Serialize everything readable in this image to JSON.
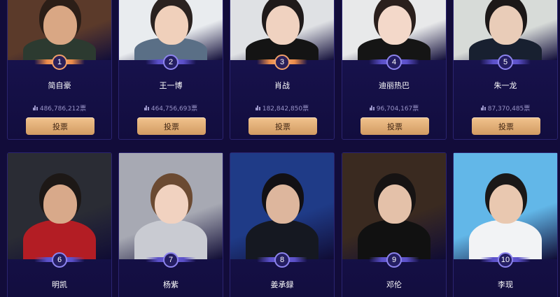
{
  "vote_label": "投票",
  "row1": [
    {
      "rank": "1",
      "name": "简自豪",
      "votes": "486,786,212票",
      "top": true,
      "colors": {
        "bg": "#5b3a2a",
        "skin": "#d9a784",
        "hair": "#2b1e17",
        "shirt": "#2c3a30"
      }
    },
    {
      "rank": "2",
      "name": "王一博",
      "votes": "464,756,693票",
      "top": false,
      "colors": {
        "bg": "#e9ecef",
        "skin": "#f0d0bb",
        "hair": "#2a2220",
        "shirt": "#5a6f86"
      }
    },
    {
      "rank": "3",
      "name": "肖战",
      "votes": "182,842,850票",
      "top": true,
      "colors": {
        "bg": "#dfe1e4",
        "skin": "#f0d2c0",
        "hair": "#1f1a1a",
        "shirt": "#141414"
      }
    },
    {
      "rank": "4",
      "name": "迪丽热巴",
      "votes": "96,704,167票",
      "top": false,
      "colors": {
        "bg": "#e8e9ea",
        "skin": "#f3d8c9",
        "hair": "#2a1f1c",
        "shirt": "#151515"
      }
    },
    {
      "rank": "5",
      "name": "朱一龙",
      "votes": "87,370,485票",
      "top": false,
      "colors": {
        "bg": "#d7dbd8",
        "skin": "#e9ccb8",
        "hair": "#1c1818",
        "shirt": "#182030"
      }
    }
  ],
  "row2": [
    {
      "rank": "6",
      "name": "明凯",
      "top": false,
      "colors": {
        "bg": "#2a2c34",
        "skin": "#d8a98a",
        "hair": "#1d1816",
        "shirt": "#b31d24"
      }
    },
    {
      "rank": "7",
      "name": "杨紫",
      "top": false,
      "colors": {
        "bg": "#a7a9b3",
        "skin": "#f1d2c0",
        "hair": "#6b4a32",
        "shirt": "#c9cbd2"
      }
    },
    {
      "rank": "8",
      "name": "姜承録",
      "top": false,
      "colors": {
        "bg": "#1f3b87",
        "skin": "#ddb69d",
        "hair": "#121014",
        "shirt": "#151821"
      }
    },
    {
      "rank": "9",
      "name": "邓伦",
      "top": false,
      "colors": {
        "bg": "#3a2a20",
        "skin": "#e4c1a9",
        "hair": "#161313",
        "shirt": "#111111"
      }
    },
    {
      "rank": "10",
      "name": "李现",
      "top": false,
      "colors": {
        "bg": "#62b7e8",
        "skin": "#e9c8b0",
        "hair": "#1a1818",
        "shirt": "#f2f3f5"
      }
    }
  ]
}
